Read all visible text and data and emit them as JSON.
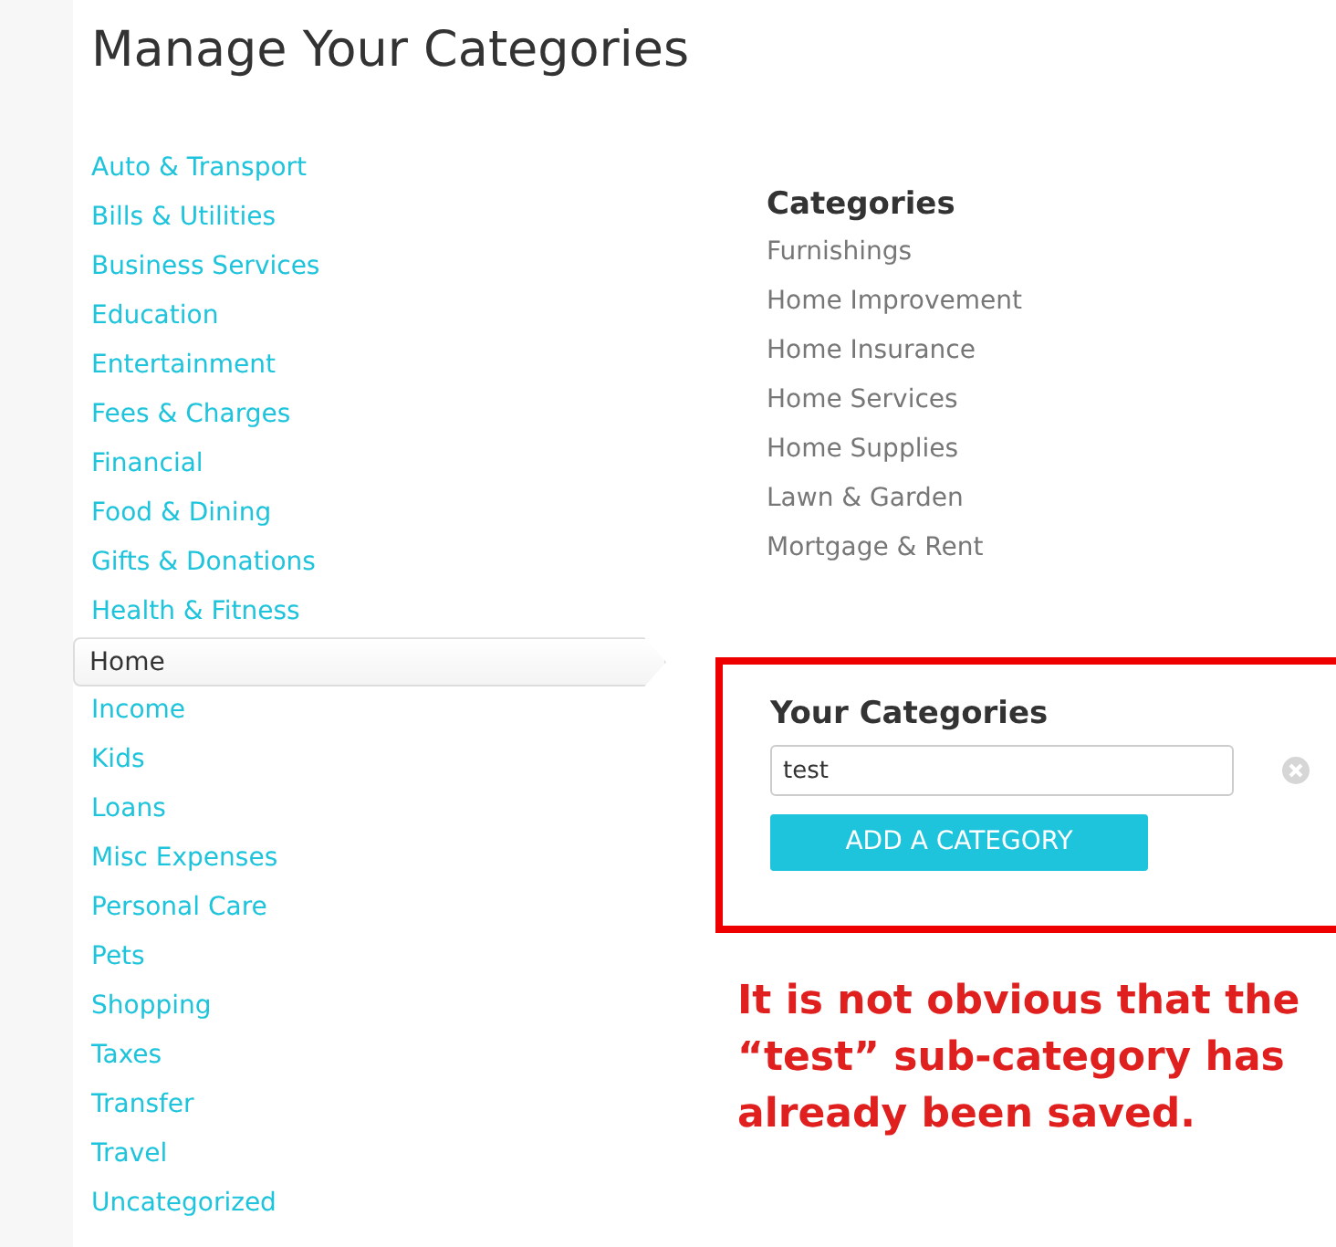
{
  "title": "Manage Your Categories",
  "categories": [
    {
      "label": "Auto & Transport",
      "selected": false
    },
    {
      "label": "Bills & Utilities",
      "selected": false
    },
    {
      "label": "Business Services",
      "selected": false
    },
    {
      "label": "Education",
      "selected": false
    },
    {
      "label": "Entertainment",
      "selected": false
    },
    {
      "label": "Fees & Charges",
      "selected": false
    },
    {
      "label": "Financial",
      "selected": false
    },
    {
      "label": "Food & Dining",
      "selected": false
    },
    {
      "label": "Gifts & Donations",
      "selected": false
    },
    {
      "label": "Health & Fitness",
      "selected": false
    },
    {
      "label": "Home",
      "selected": true
    },
    {
      "label": "Income",
      "selected": false
    },
    {
      "label": "Kids",
      "selected": false
    },
    {
      "label": "Loans",
      "selected": false
    },
    {
      "label": "Misc Expenses",
      "selected": false
    },
    {
      "label": "Personal Care",
      "selected": false
    },
    {
      "label": "Pets",
      "selected": false
    },
    {
      "label": "Shopping",
      "selected": false
    },
    {
      "label": "Taxes",
      "selected": false
    },
    {
      "label": "Transfer",
      "selected": false
    },
    {
      "label": "Travel",
      "selected": false
    },
    {
      "label": "Uncategorized",
      "selected": false
    }
  ],
  "subcategories": {
    "heading": "Categories",
    "items": [
      "Furnishings",
      "Home Improvement",
      "Home Insurance",
      "Home Services",
      "Home Supplies",
      "Lawn & Garden",
      "Mortgage & Rent"
    ]
  },
  "your_categories": {
    "heading": "Your Categories",
    "entries": [
      {
        "value": "test"
      }
    ],
    "button": "ADD A CATEGORY"
  },
  "annotation": "It is not obvious that the “test” sub-category has already been saved."
}
